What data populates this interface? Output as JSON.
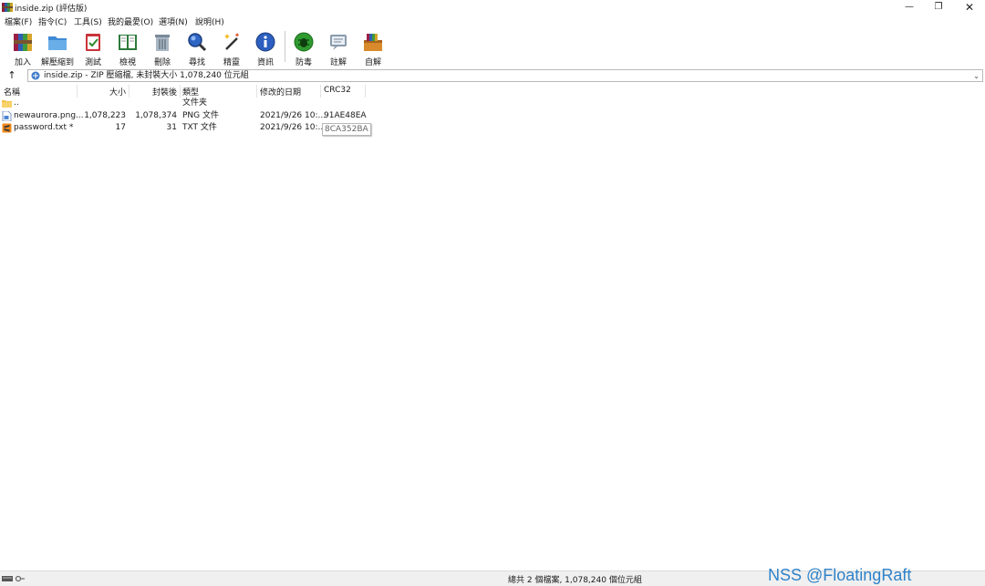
{
  "window": {
    "title": "inside.zip (評估版)",
    "icons": {
      "app": "winrar-books-icon",
      "min": "minimize-icon",
      "max": "restore-icon",
      "close": "close-icon"
    }
  },
  "menu": [
    "檔案(F)",
    "指令(C)",
    "工具(S)",
    "我的最愛(O)",
    "選項(N)",
    "說明(H)"
  ],
  "toolbar": [
    {
      "label": "加入",
      "icon": "add-archive-icon"
    },
    {
      "label": "解壓縮到",
      "icon": "extract-folder-icon"
    },
    {
      "label": "測試",
      "icon": "test-clipboard-icon"
    },
    {
      "label": "檢視",
      "icon": "view-book-icon"
    },
    {
      "label": "刪除",
      "icon": "trash-icon"
    },
    {
      "label": "尋找",
      "icon": "magnifier-icon"
    },
    {
      "label": "精靈",
      "icon": "wizard-wand-icon"
    },
    {
      "label": "資訊",
      "icon": "info-icon"
    },
    {
      "label": "防毒",
      "icon": "antivirus-bug-icon"
    },
    {
      "label": "註解",
      "icon": "comment-icon"
    },
    {
      "label": "自解",
      "icon": "sfx-box-icon"
    }
  ],
  "address": {
    "up_icon": "up-arrow-icon",
    "text": "inside.zip - ZIP 壓縮檔, 未封裝大小 1,078,240 位元組",
    "dropdown_icon": "chevron-down-icon"
  },
  "columns": {
    "name": "名稱",
    "size": "大小",
    "packed": "封裝後",
    "type": "類型",
    "modified": "修改的日期",
    "crc": "CRC32"
  },
  "rows": [
    {
      "name": "..",
      "size": "",
      "packed": "",
      "type": "文件夹",
      "modified": "",
      "crc": "",
      "icon": "folder-icon"
    },
    {
      "name": "newaurora.png...",
      "size": "1,078,223",
      "packed": "1,078,374",
      "type": "PNG 文件",
      "modified": "2021/9/26 10:...",
      "crc": "91AE48EA",
      "icon": "png-file-icon"
    },
    {
      "name": "password.txt *",
      "size": "17",
      "packed": "31",
      "type": "TXT 文件",
      "modified": "2021/9/26 10:...",
      "crc": "",
      "icon": "sublime-text-file-icon"
    }
  ],
  "tooltip": "8CA352BA",
  "status": {
    "icon": "drive-key-icon",
    "text": "總共 2 個檔案, 1,078,240 個位元組"
  },
  "watermark": "NSS @FloatingRaft",
  "colors": {
    "watermark": "#2e82c9",
    "selection_accent": "#0078d7"
  }
}
